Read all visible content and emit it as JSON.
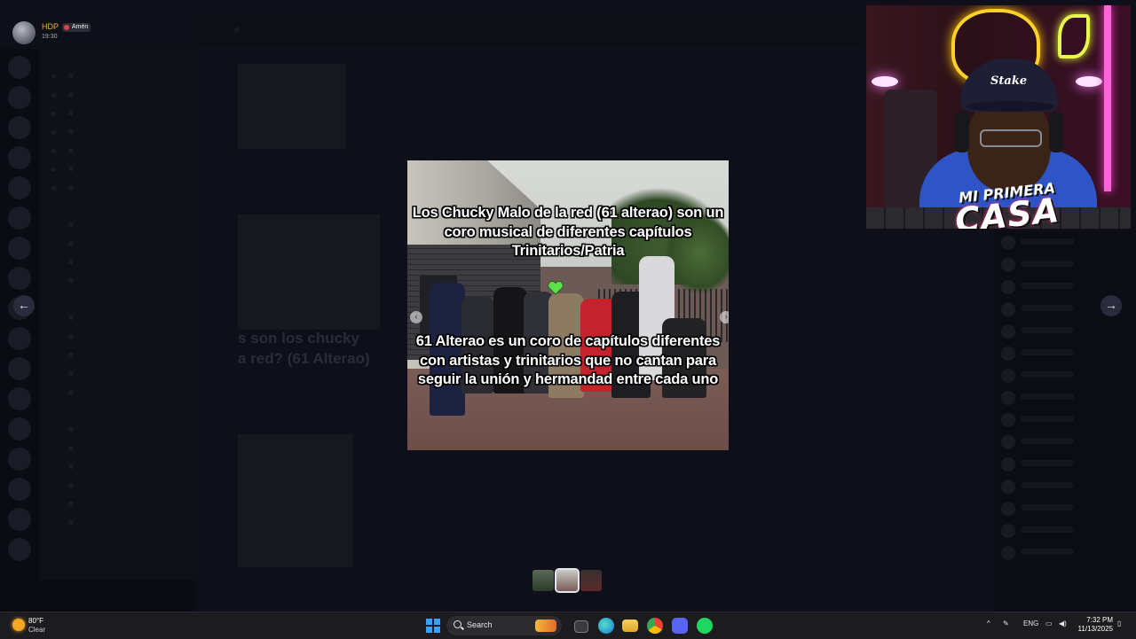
{
  "profile": {
    "name": "HDP",
    "badge": "Amén",
    "time": "19:30"
  },
  "media": {
    "caption_top": "Los Chucky Malo de la red (61 alterao) son un coro musical de diferentes capítulos Trinitarios/Patria",
    "caption_bottom": "61 Alterao es un coro de capítulos diferentes con artistas y trinitarios que no cantan para seguir la unión y hermandad entre cada uno"
  },
  "background": {
    "ghost_title": "s son los chucky",
    "ghost_title2": "a red? (61 Alterao)"
  },
  "webcam": {
    "cap_logo": "Stake",
    "overlay_line1": "MI PRIMERA",
    "overlay_line2": "CASA"
  },
  "navigation": {
    "prev_icon": "arrow-left-icon",
    "next_icon": "arrow-right-icon"
  },
  "taskbar": {
    "weather_temp": "80°F",
    "weather_condition": "Clear",
    "search_label": "Search",
    "language": "ENG",
    "time": "7:32 PM",
    "date": "11/13/2025"
  },
  "colors": {
    "backdrop": "#0e0f18",
    "taskbar": "#1c1c1f",
    "accent_blue": "#3aa0ff",
    "profile_name": "#e8b04a"
  }
}
